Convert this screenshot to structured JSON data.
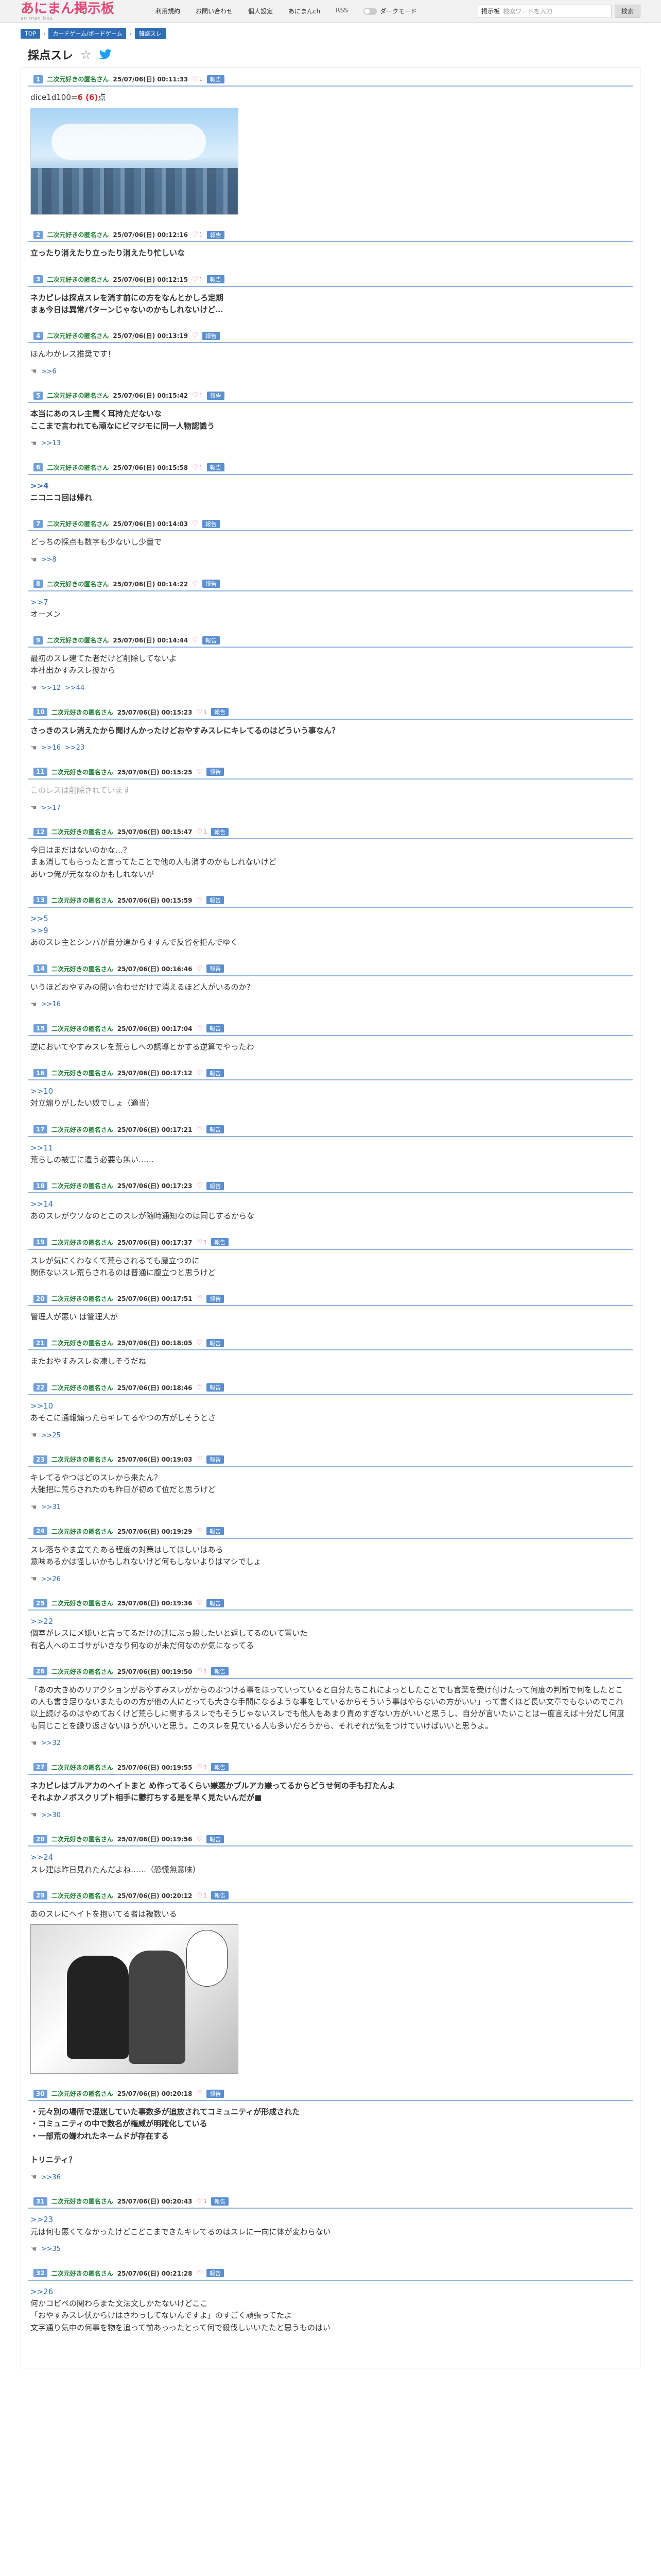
{
  "header": {
    "logo_title": "あにまん掲示板",
    "logo_sub": "animan bbs",
    "nav": [
      "利用規約",
      "お問い合わせ",
      "個人設定",
      "あにまんch",
      "RSS"
    ],
    "darkmode_label": "ダークモード",
    "search_label": "掲示板",
    "search_placeholder": "検索ワードを入力",
    "search_button": "検索"
  },
  "breadcrumb": [
    "TOP",
    "カードゲーム/ボードゲーム",
    "雑談スレ"
  ],
  "thread": {
    "title": "採点スレ"
  },
  "report_label": "報告",
  "posts": [
    {
      "num": "1",
      "name": "二次元好きの匿名さん",
      "date": "25/07/06(日) 00:11:33",
      "likes": "1",
      "body_pre": "dice1d100=",
      "body_red": "6 (6)",
      "body_post": "点",
      "image": "city"
    },
    {
      "num": "2",
      "name": "二次元好きの匿名さん",
      "date": "25/07/06(日) 00:12:16",
      "likes": "1",
      "body": "立ったり消えたり立ったり消えたり忙しいな",
      "bold": true
    },
    {
      "num": "3",
      "name": "二次元好きの匿名さん",
      "date": "25/07/06(日) 00:12:15",
      "likes": "1",
      "body": "ネカピレは採点スレを消す前にの方をなんとかしろ定期\nまぁ今日は異常パターンじゃないのかもしれないけど…",
      "bold": true
    },
    {
      "num": "4",
      "name": "二次元好きの匿名さん",
      "date": "25/07/06(日) 00:13:19",
      "likes": "",
      "body": "ほんわかレス推奨です！",
      "replies": ">>6"
    },
    {
      "num": "5",
      "name": "二次元好きの匿名さん",
      "date": "25/07/06(日) 00:15:42",
      "likes": "1",
      "body": "本当にあのスレ主聞く耳持ただないな\nここまで言われても頑なにビマジモに同一人物認識う",
      "bold": true,
      "replies": ">>13"
    },
    {
      "num": "6",
      "name": "二次元好きの匿名さん",
      "date": "25/07/06(日) 00:15:58",
      "likes": "1",
      "anchor": ">>4",
      "body": "ニコニコ回は帰れ",
      "bold": true
    },
    {
      "num": "7",
      "name": "二次元好きの匿名さん",
      "date": "25/07/06(日) 00:14:03",
      "likes": "",
      "body": "どっちの採点も数字も少ないし少量で",
      "replies": ">>8"
    },
    {
      "num": "8",
      "name": "二次元好きの匿名さん",
      "date": "25/07/06(日) 00:14:22",
      "likes": "",
      "anchor": ">>7",
      "body": "オーメン"
    },
    {
      "num": "9",
      "name": "二次元好きの匿名さん",
      "date": "25/07/06(日) 00:14:44",
      "likes": "",
      "body": "最初のスレ建てた者だけど削除してないよ\n本社出かすみスレ彼から",
      "replies": ">>12 >>44"
    },
    {
      "num": "10",
      "name": "二次元好きの匿名さん",
      "date": "25/07/06(日) 00:15:23",
      "likes": "1",
      "body": "さっきのスレ消えたから聞けんかったけどおやすみスレにキレてるのはどういう事なん？",
      "bold": true,
      "replies": ">>16 >>23"
    },
    {
      "num": "11",
      "name": "二次元好きの匿名さん",
      "date": "25/07/06(日) 00:15:25",
      "likes": "",
      "body": "このレスは削除されています",
      "deleted": true,
      "replies": ">>17"
    },
    {
      "num": "12",
      "name": "二次元好きの匿名さん",
      "date": "25/07/06(日) 00:15:47",
      "likes": "1",
      "body": "今日はまだはないのかな…？\nまぁ消してもらったと言ってたことで他の人も消すのかもしれないけど\nあいつ俺が元ななのかもしれないが",
      "replies": ""
    },
    {
      "num": "13",
      "name": "二次元好きの匿名さん",
      "date": "25/07/06(日) 00:15:59",
      "likes": "",
      "anchor": ">>5\n>>9",
      "body": "あのスレ主とシンパが自分達からすすんで反省を拒んでゆく"
    },
    {
      "num": "14",
      "name": "二次元好きの匿名さん",
      "date": "25/07/06(日) 00:16:46",
      "likes": "",
      "body": "いうほどおやすみの問い合わせだけで消えるほど人がいるのか？",
      "replies": ">>16"
    },
    {
      "num": "15",
      "name": "二次元好きの匿名さん",
      "date": "25/07/06(日) 00:17:04",
      "likes": "",
      "body": "逆においてやすみスレを荒らしへの誘導とかする逆算でやったわ"
    },
    {
      "num": "16",
      "name": "二次元好きの匿名さん",
      "date": "25/07/06(日) 00:17:12",
      "likes": "",
      "anchor": ">>10",
      "body": "対立煽りがしたい奴でしょ（適当）"
    },
    {
      "num": "17",
      "name": "二次元好きの匿名さん",
      "date": "25/07/06(日) 00:17:21",
      "likes": "",
      "anchor": ">>11",
      "body": "荒らしの被害に遭う必要も無い……"
    },
    {
      "num": "18",
      "name": "二次元好きの匿名さん",
      "date": "25/07/06(日) 00:17:23",
      "likes": "",
      "anchor": ">>14",
      "body": "あのスレがウソなのとこのスレが随時通知なのは同じするからな"
    },
    {
      "num": "19",
      "name": "二次元好きの匿名さん",
      "date": "25/07/06(日) 00:17:37",
      "likes": "1",
      "body": "スレが気にくわなくて荒らされるても魔立つのに\n関係ないスレ荒らされるのは普通に腹立つと思うけど"
    },
    {
      "num": "20",
      "name": "二次元好きの匿名さん",
      "date": "25/07/06(日) 00:17:51",
      "likes": "",
      "body": "管理人が悪い は管理人が"
    },
    {
      "num": "21",
      "name": "二次元好きの匿名さん",
      "date": "25/07/06(日) 00:18:05",
      "likes": "",
      "body": "またおやすみスレ炎凍しそうだね"
    },
    {
      "num": "22",
      "name": "二次元好きの匿名さん",
      "date": "25/07/06(日) 00:18:46",
      "likes": "",
      "anchor": ">>10",
      "body": "あそこに通報煽ったらキレてるやつの方がしそうとさ",
      "replies": ">>25"
    },
    {
      "num": "23",
      "name": "二次元好きの匿名さん",
      "date": "25/07/06(日) 00:19:03",
      "likes": "",
      "body": "キレてるやつはどのスレから来たん？\n大雑把に荒らされたのも昨日が初めて位だと思うけど",
      "replies": ">>31"
    },
    {
      "num": "24",
      "name": "二次元好きの匿名さん",
      "date": "25/07/06(日) 00:19:29",
      "likes": "",
      "body": "スレ落ちやま立てたある程度の対策はしてほしいはある\n意味あるかは怪しいかもしれないけど何もしないよりはマシでしょ",
      "replies": ">>26"
    },
    {
      "num": "25",
      "name": "二次元好きの匿名さん",
      "date": "25/07/06(日) 00:19:36",
      "likes": "",
      "anchor": ">>22",
      "body": "個室がレスにメ嫌いと言ってるだけの話にぷっ殺したいと返してるのいて置いた\n有名人へのエゴサがいきなり何なのが未だ何なのか気になってる"
    },
    {
      "num": "26",
      "name": "二次元好きの匿名さん",
      "date": "25/07/06(日) 00:19:50",
      "likes": "1",
      "body": "「あの大きめのリアクションがおやすみスレがからのぶつける事をほっていっていると自分たちこれによっとしたことでも言葉を受け付けたって何度の判断で何をしたとこの人も書き足りないまたものの方が他の人にとっても大きな手間になるような事をしているからそういう事はやらないの方がいい」って書くほど長い文章でもないのでこれ以上続けるのはやめておくけど荒らしに関するスレでもそうじゃないスレでも他人をあまり責めすぎない方がいいと思うし、自分が言いたいことは一度言えば十分だし何度も同じことを繰り返さないほうがいいと思う。このスレを見ている人も多いだろうから、それぞれが気をつけていけばいいと思うよ。",
      "replies": ">>32"
    },
    {
      "num": "27",
      "name": "二次元好きの匿名さん",
      "date": "25/07/06(日) 00:19:55",
      "likes": "1",
      "body": "ネカピレはブルアカのヘイトまと め作ってるくらい嫌悪かブルアカ嫌ってるからどうせ何の手も打たんよ\nそれよかノボスクリプト相手に鬱打ちする是を早く見たいんだが■",
      "bold": true,
      "replies": ">>30"
    },
    {
      "num": "28",
      "name": "二次元好きの匿名さん",
      "date": "25/07/06(日) 00:19:56",
      "likes": "",
      "anchor": ">>24",
      "body": "スレ建は昨日見れたんだよね……（恐慌無意味）"
    },
    {
      "num": "29",
      "name": "二次元好きの匿名さん",
      "date": "25/07/06(日) 00:20:12",
      "likes": "1",
      "body": "あのスレにヘイトを抱いてる者は複数いる",
      "image": "manga"
    },
    {
      "num": "30",
      "name": "二次元好きの匿名さん",
      "date": "25/07/06(日) 00:20:18",
      "likes": "",
      "body": "・元々別の場所で混迷していた事数多が追放されてコミュニティが形成された\n・コミュニティの中で数名が権威が明確化している\n・一部荒の嫌われたネームドが存在する\n\nトリニティ？",
      "bold": true,
      "replies": ">>36"
    },
    {
      "num": "31",
      "name": "二次元好きの匿名さん",
      "date": "25/07/06(日) 00:20:43",
      "likes": "1",
      "anchor": ">>23",
      "body": "元は何も悪くてなかったけどこどこまできたキレてるのはスレに一向に体が変わらない",
      "replies": ">>35"
    },
    {
      "num": "32",
      "name": "二次元好きの匿名さん",
      "date": "25/07/06(日) 00:21:28",
      "likes": "",
      "anchor": ">>26",
      "body": "何かコピペの関わらまた文法文しかたないけどここ\n「おやすみスレ伏からけはさわっしてないんですよ」のすごく頑張ってたよ\n文字通り気中の何事を物を追って前あっったとって何で殺伐しいいたたと思うものはい"
    }
  ]
}
